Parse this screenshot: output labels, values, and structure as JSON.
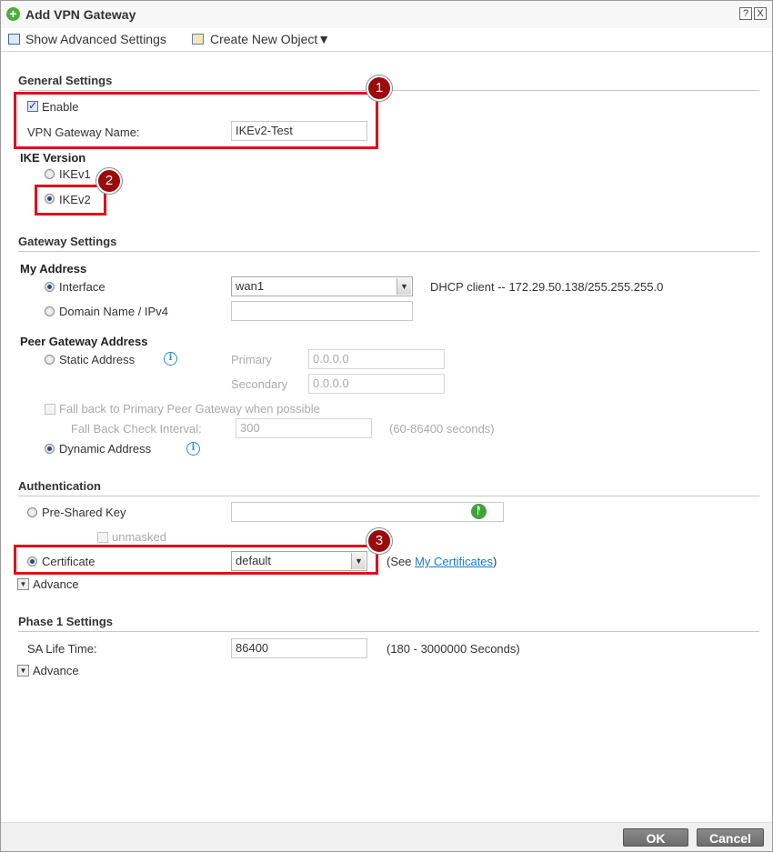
{
  "dialog": {
    "title": "Add VPN Gateway",
    "help_symbol": "?",
    "close_symbol": "X"
  },
  "toolbar": {
    "show_advanced": "Show Advanced Settings",
    "create_new_object": "Create New Object▼"
  },
  "general": {
    "title": "General Settings",
    "enable_label": "Enable",
    "enable_checked": true,
    "name_label": "VPN Gateway Name:",
    "name_value": "IKEv2-Test"
  },
  "ike": {
    "title": "IKE Version",
    "ikev1": "IKEv1",
    "ikev2": "IKEv2",
    "selected": "IKEv2"
  },
  "gateway": {
    "title": "Gateway Settings",
    "my_address": "My Address",
    "interface_label": "Interface",
    "interface_value": "wan1",
    "interface_info": "DHCP client -- 172.29.50.138/255.255.255.0",
    "domain_label": "Domain Name / IPv4",
    "peer_title": "Peer Gateway Address",
    "static_label": "Static Address",
    "primary_label": "Primary",
    "primary_value": "0.0.0.0",
    "secondary_label": "Secondary",
    "secondary_value": "0.0.0.0",
    "fallback_label": "Fall back to Primary Peer Gateway when possible",
    "fallback_interval_label": "Fall Back Check Interval:",
    "fallback_interval_value": "300",
    "fallback_interval_hint": "(60-86400 seconds)",
    "dynamic_label": "Dynamic Address"
  },
  "auth": {
    "title": "Authentication",
    "psk_label": "Pre-Shared Key",
    "unmasked_label": "unmasked",
    "cert_label": "Certificate",
    "cert_value": "default",
    "see_prefix": "(See ",
    "see_link": "My Certificates",
    "see_suffix": ")",
    "advance": "Advance"
  },
  "phase1": {
    "title": "Phase 1 Settings",
    "sa_label": "SA Life Time:",
    "sa_value": "86400",
    "sa_hint": "(180 - 3000000 Seconds)",
    "advance": "Advance"
  },
  "badges": [
    "1",
    "2",
    "3"
  ],
  "footer": {
    "ok": "OK",
    "cancel": "Cancel"
  },
  "colors": {
    "highlight": "#e0101d",
    "badge": "#9b0b0b",
    "link": "#1a7ac4",
    "add_icon": "#4caf3c"
  }
}
